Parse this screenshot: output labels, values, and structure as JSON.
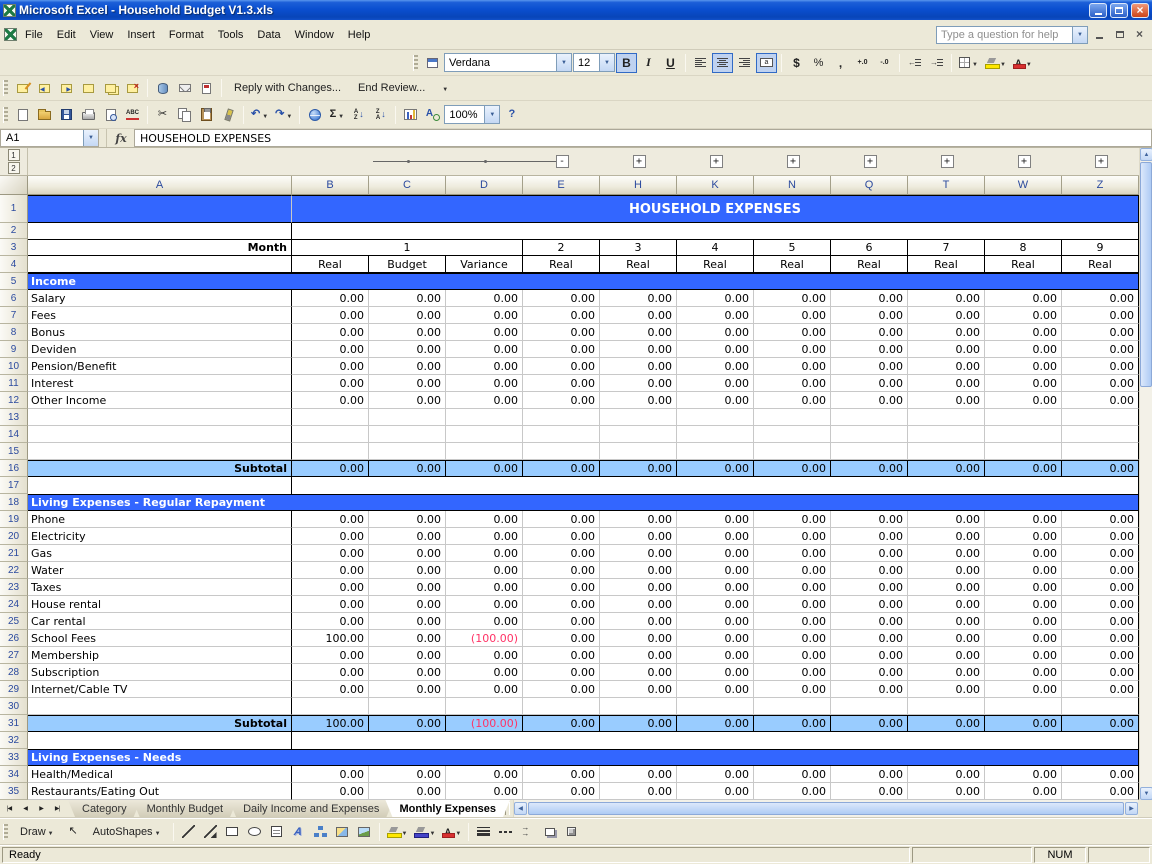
{
  "window": {
    "title": "Microsoft Excel - Household Budget V1.3.xls"
  },
  "menu": {
    "items": [
      "File",
      "Edit",
      "View",
      "Insert",
      "Format",
      "Tools",
      "Data",
      "Window",
      "Help"
    ],
    "help_placeholder": "Type a question for help"
  },
  "formatting_toolbar": {
    "font_name": "Verdana",
    "font_size": "12",
    "bold": "B",
    "italic": "I",
    "underline": "U",
    "currency": "$",
    "percent": "%",
    "comma": ","
  },
  "reviewing_toolbar": {
    "reply_label": "Reply with Changes...",
    "end_review_label": "End Review..."
  },
  "standard_toolbar": {
    "zoom": "100%"
  },
  "formula_bar": {
    "name_box": "A1",
    "fx": "fx",
    "value": "HOUSEHOLD EXPENSES"
  },
  "icons": {
    "cut": "✂",
    "undo": "↶",
    "redo": "↷",
    "autosum": "Σ",
    "help": "?",
    "sort_a": "A",
    "sort_z": "Z",
    "sort_arrow": "↓",
    "spelling": "ABC",
    "select_pointer": "↖",
    "line": "\\",
    "wordart_a": "A",
    "increase_decimal": "+.0",
    "decrease_decimal": "-.0",
    "indent_left": "←",
    "indent_right": "→"
  },
  "colors": {
    "header_blue": "#3366FF",
    "subtotal_blue": "#99CCFF",
    "negative": "#FF3366"
  },
  "grid": {
    "outline_levels": [
      "1",
      "2"
    ],
    "columns": [
      "A",
      "B",
      "C",
      "D",
      "E",
      "H",
      "K",
      "N",
      "Q",
      "T",
      "W",
      "Z"
    ],
    "title": "HOUSEHOLD EXPENSES",
    "month_label": "Month",
    "month_group_first": "1",
    "months_rest": [
      "2",
      "3",
      "4",
      "5",
      "6",
      "7",
      "8",
      "9"
    ],
    "subheaders": [
      "Real",
      "Budget",
      "Variance",
      "Real",
      "Real",
      "Real",
      "Real",
      "Real",
      "Real",
      "Real",
      "Real"
    ],
    "rows": [
      {
        "n": 1,
        "t": "title"
      },
      {
        "n": 2,
        "t": "blank"
      },
      {
        "n": 3,
        "t": "month"
      },
      {
        "n": 4,
        "t": "subhdr"
      },
      {
        "n": 5,
        "t": "section",
        "label": "Income"
      },
      {
        "n": 6,
        "t": "data",
        "label": "Salary",
        "v": [
          "0.00",
          "0.00",
          "0.00",
          "0.00",
          "0.00",
          "0.00",
          "0.00",
          "0.00",
          "0.00",
          "0.00",
          "0.00"
        ]
      },
      {
        "n": 7,
        "t": "data",
        "label": "Fees",
        "v": [
          "0.00",
          "0.00",
          "0.00",
          "0.00",
          "0.00",
          "0.00",
          "0.00",
          "0.00",
          "0.00",
          "0.00",
          "0.00"
        ]
      },
      {
        "n": 8,
        "t": "data",
        "label": "Bonus",
        "v": [
          "0.00",
          "0.00",
          "0.00",
          "0.00",
          "0.00",
          "0.00",
          "0.00",
          "0.00",
          "0.00",
          "0.00",
          "0.00"
        ]
      },
      {
        "n": 9,
        "t": "data",
        "label": "Deviden",
        "v": [
          "0.00",
          "0.00",
          "0.00",
          "0.00",
          "0.00",
          "0.00",
          "0.00",
          "0.00",
          "0.00",
          "0.00",
          "0.00"
        ]
      },
      {
        "n": 10,
        "t": "data",
        "label": "Pension/Benefit",
        "v": [
          "0.00",
          "0.00",
          "0.00",
          "0.00",
          "0.00",
          "0.00",
          "0.00",
          "0.00",
          "0.00",
          "0.00",
          "0.00"
        ]
      },
      {
        "n": 11,
        "t": "data",
        "label": "Interest",
        "v": [
          "0.00",
          "0.00",
          "0.00",
          "0.00",
          "0.00",
          "0.00",
          "0.00",
          "0.00",
          "0.00",
          "0.00",
          "0.00"
        ]
      },
      {
        "n": 12,
        "t": "data",
        "label": "Other Income",
        "v": [
          "0.00",
          "0.00",
          "0.00",
          "0.00",
          "0.00",
          "0.00",
          "0.00",
          "0.00",
          "0.00",
          "0.00",
          "0.00"
        ]
      },
      {
        "n": 13,
        "t": "data",
        "label": "",
        "v": [
          "",
          "",
          "",
          "",
          "",
          "",
          "",
          "",
          "",
          "",
          ""
        ]
      },
      {
        "n": 14,
        "t": "data",
        "label": "",
        "v": [
          "",
          "",
          "",
          "",
          "",
          "",
          "",
          "",
          "",
          "",
          ""
        ]
      },
      {
        "n": 15,
        "t": "data",
        "label": "",
        "v": [
          "",
          "",
          "",
          "",
          "",
          "",
          "",
          "",
          "",
          "",
          ""
        ]
      },
      {
        "n": 16,
        "t": "subtotal",
        "label": "Subtotal",
        "v": [
          "0.00",
          "0.00",
          "0.00",
          "0.00",
          "0.00",
          "0.00",
          "0.00",
          "0.00",
          "0.00",
          "0.00",
          "0.00"
        ]
      },
      {
        "n": 17,
        "t": "blank"
      },
      {
        "n": 18,
        "t": "section",
        "label": "Living Expenses - Regular Repayment"
      },
      {
        "n": 19,
        "t": "data",
        "label": "Phone",
        "v": [
          "0.00",
          "0.00",
          "0.00",
          "0.00",
          "0.00",
          "0.00",
          "0.00",
          "0.00",
          "0.00",
          "0.00",
          "0.00"
        ]
      },
      {
        "n": 20,
        "t": "data",
        "label": "Electricity",
        "v": [
          "0.00",
          "0.00",
          "0.00",
          "0.00",
          "0.00",
          "0.00",
          "0.00",
          "0.00",
          "0.00",
          "0.00",
          "0.00"
        ]
      },
      {
        "n": 21,
        "t": "data",
        "label": "Gas",
        "v": [
          "0.00",
          "0.00",
          "0.00",
          "0.00",
          "0.00",
          "0.00",
          "0.00",
          "0.00",
          "0.00",
          "0.00",
          "0.00"
        ]
      },
      {
        "n": 22,
        "t": "data",
        "label": "Water",
        "v": [
          "0.00",
          "0.00",
          "0.00",
          "0.00",
          "0.00",
          "0.00",
          "0.00",
          "0.00",
          "0.00",
          "0.00",
          "0.00"
        ]
      },
      {
        "n": 23,
        "t": "data",
        "label": "Taxes",
        "v": [
          "0.00",
          "0.00",
          "0.00",
          "0.00",
          "0.00",
          "0.00",
          "0.00",
          "0.00",
          "0.00",
          "0.00",
          "0.00"
        ]
      },
      {
        "n": 24,
        "t": "data",
        "label": "House rental",
        "v": [
          "0.00",
          "0.00",
          "0.00",
          "0.00",
          "0.00",
          "0.00",
          "0.00",
          "0.00",
          "0.00",
          "0.00",
          "0.00"
        ]
      },
      {
        "n": 25,
        "t": "data",
        "label": "Car rental",
        "v": [
          "0.00",
          "0.00",
          "0.00",
          "0.00",
          "0.00",
          "0.00",
          "0.00",
          "0.00",
          "0.00",
          "0.00",
          "0.00"
        ]
      },
      {
        "n": 26,
        "t": "data",
        "label": "School Fees",
        "v": [
          "100.00",
          "0.00",
          "(100.00)",
          "0.00",
          "0.00",
          "0.00",
          "0.00",
          "0.00",
          "0.00",
          "0.00",
          "0.00"
        ]
      },
      {
        "n": 27,
        "t": "data",
        "label": "Membership",
        "v": [
          "0.00",
          "0.00",
          "0.00",
          "0.00",
          "0.00",
          "0.00",
          "0.00",
          "0.00",
          "0.00",
          "0.00",
          "0.00"
        ]
      },
      {
        "n": 28,
        "t": "data",
        "label": "Subscription",
        "v": [
          "0.00",
          "0.00",
          "0.00",
          "0.00",
          "0.00",
          "0.00",
          "0.00",
          "0.00",
          "0.00",
          "0.00",
          "0.00"
        ]
      },
      {
        "n": 29,
        "t": "data",
        "label": "Internet/Cable TV",
        "v": [
          "0.00",
          "0.00",
          "0.00",
          "0.00",
          "0.00",
          "0.00",
          "0.00",
          "0.00",
          "0.00",
          "0.00",
          "0.00"
        ]
      },
      {
        "n": 30,
        "t": "data",
        "label": "",
        "v": [
          "",
          "",
          "",
          "",
          "",
          "",
          "",
          "",
          "",
          "",
          ""
        ]
      },
      {
        "n": 31,
        "t": "subtotal",
        "label": "Subtotal",
        "v": [
          "100.00",
          "0.00",
          "(100.00)",
          "0.00",
          "0.00",
          "0.00",
          "0.00",
          "0.00",
          "0.00",
          "0.00",
          "0.00"
        ]
      },
      {
        "n": 32,
        "t": "blank"
      },
      {
        "n": 33,
        "t": "section",
        "label": "Living Expenses - Needs"
      },
      {
        "n": 34,
        "t": "data",
        "label": "Health/Medical",
        "v": [
          "0.00",
          "0.00",
          "0.00",
          "0.00",
          "0.00",
          "0.00",
          "0.00",
          "0.00",
          "0.00",
          "0.00",
          "0.00"
        ]
      },
      {
        "n": 35,
        "t": "data",
        "label": "Restaurants/Eating Out",
        "v": [
          "0.00",
          "0.00",
          "0.00",
          "0.00",
          "0.00",
          "0.00",
          "0.00",
          "0.00",
          "0.00",
          "0.00",
          "0.00"
        ]
      }
    ]
  },
  "sheet_tabs": [
    "Category",
    "Monthly Budget",
    "Daily Income and Expenses",
    "Monthly Expenses"
  ],
  "active_tab": "Monthly Expenses",
  "drawing_toolbar": {
    "draw": "Draw",
    "autoshapes": "AutoShapes"
  },
  "status_bar": {
    "left": "Ready",
    "num": "NUM"
  }
}
